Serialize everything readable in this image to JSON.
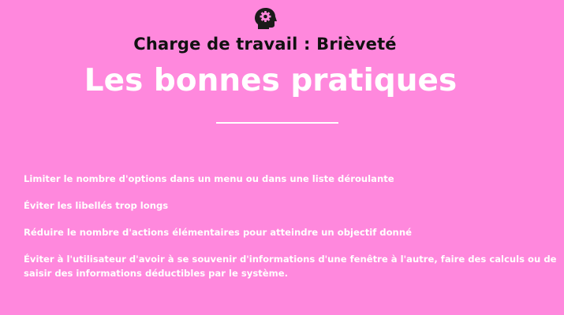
{
  "slide": {
    "icon": "head-gear-icon",
    "subtitle": "Charge de travail : Brièveté",
    "title": "Les bonnes pratiques",
    "practices": [
      "Limiter le nombre d'options dans un menu ou dans une liste déroulante",
      "Éviter les libellés trop longs",
      "Réduire le nombre d'actions élémentaires pour atteindre un objectif donné",
      "Éviter à l'utilisateur d'avoir à se souvenir d'informations d'une fenêtre à l'autre, faire des calculs ou de saisir des informations déductibles par le système."
    ]
  },
  "colors": {
    "background": "#ff88dd",
    "title": "#ffffff",
    "subtitle": "#111111",
    "icon": "#1a1a1a"
  }
}
